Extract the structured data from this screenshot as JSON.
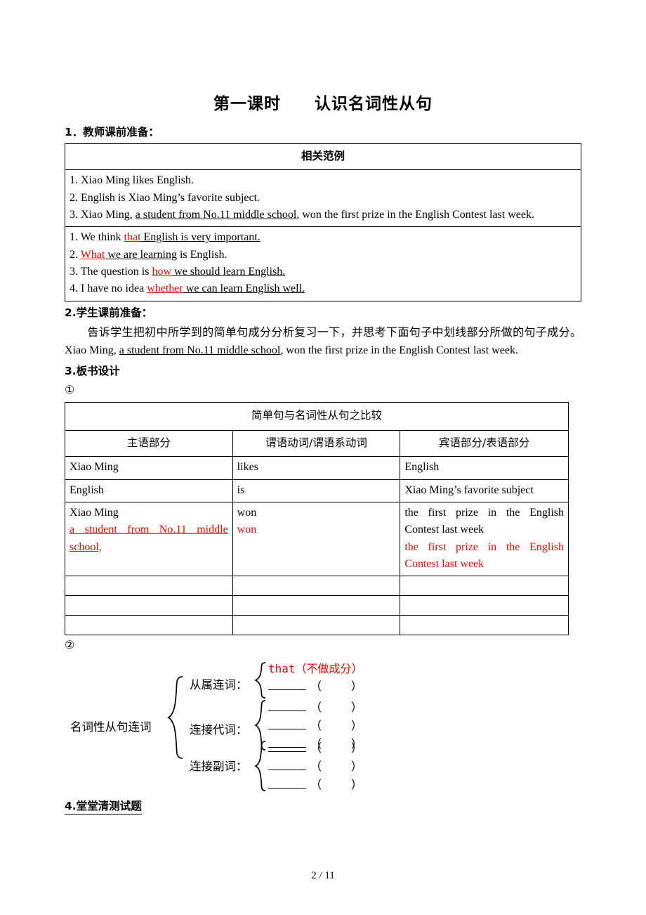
{
  "title": "第一课时　　认识名词性从句",
  "sections": {
    "teacher_prep_heading": "1．教师课前准备：",
    "student_prep_heading": "2.学生课前准备：",
    "board_design_heading": "3.板书设计",
    "quiz_heading": "4.堂堂清测试题",
    "marker_1": "①",
    "marker_2": "②"
  },
  "examples_table": {
    "banner": "相关范例",
    "group1": {
      "line1": "1. Xiao Ming likes English.",
      "line2": "2. English is Xiao Ming’s favorite subject.",
      "line3_a": "3. Xiao Ming, ",
      "line3_underlined": "a student from No.11 middle school",
      "line3_b": ", won the first prize in the English Contest last week."
    },
    "group2": {
      "row1_prefix": "1. We think ",
      "row1_keyword": "that",
      "row1_rest": " English is very important.",
      "row2_prefix": "2. ",
      "row2_keyword": "What",
      "row2_rest": " we are learning",
      "row2_tail": " is English.",
      "row3_prefix": "3. The question is ",
      "row3_keyword": "how",
      "row3_rest": " we should learn English.",
      "row4_prefix": "4. I have no idea ",
      "row4_keyword": "whether",
      "row4_rest": " we can learn English well."
    }
  },
  "student_prep": {
    "para_a": "告诉学生把初中所学到的简单句成分分析复习一下，并思考下面句子中划线部分所做的句子成分。Xiao Ming, ",
    "para_underlined": "a student from No.11 middle school",
    "para_b": ", won the first prize in the English Contest last week."
  },
  "comparison_table": {
    "banner": "简单句与名词性从句之比较",
    "headers": [
      "主语部分",
      "谓语动词/谓语系动词",
      "宾语部分/表语部分"
    ],
    "rows": [
      {
        "subject": "Xiao Ming",
        "verb": "likes",
        "object": "English"
      },
      {
        "subject": "English",
        "verb": "is",
        "object": "Xiao Ming’s favorite subject"
      },
      {
        "subject_black": "Xiao Ming",
        "subject_red": "a student from No.11 middle school,",
        "verb_black": "won",
        "verb_red": "won",
        "object_black": "the first prize in the English Contest last week",
        "object_red": "the first prize in the English Contest last week"
      },
      {
        "subject": "",
        "verb": "",
        "object": ""
      },
      {
        "subject": "",
        "verb": "",
        "object": ""
      },
      {
        "subject": "",
        "verb": "",
        "object": ""
      }
    ]
  },
  "connective_diagram": {
    "root_label": "名词性从句连词",
    "categories": [
      {
        "label": "从属连词：",
        "items": [
          {
            "type": "text",
            "word": "that",
            "note": "（不做成分）"
          },
          {
            "type": "blank",
            "open": "（",
            "close": "）"
          }
        ]
      },
      {
        "label": "连接代词：",
        "items": [
          {
            "type": "blank",
            "open": "（",
            "close": "）"
          },
          {
            "type": "blank",
            "open": "（",
            "close": "）"
          },
          {
            "type": "blank",
            "open": "（",
            "close": "）"
          }
        ]
      },
      {
        "label": "连接副词：",
        "items": [
          {
            "type": "blank",
            "open": "（",
            "close": "）"
          },
          {
            "type": "blank",
            "open": "（",
            "close": "）"
          },
          {
            "type": "blank",
            "open": "（",
            "close": "）"
          }
        ]
      }
    ]
  },
  "footer": {
    "page": "2",
    "separator": "/",
    "total": "11"
  },
  "colors": {
    "accent_red": "#ff0000",
    "text": "#000000",
    "border": "#000000"
  }
}
